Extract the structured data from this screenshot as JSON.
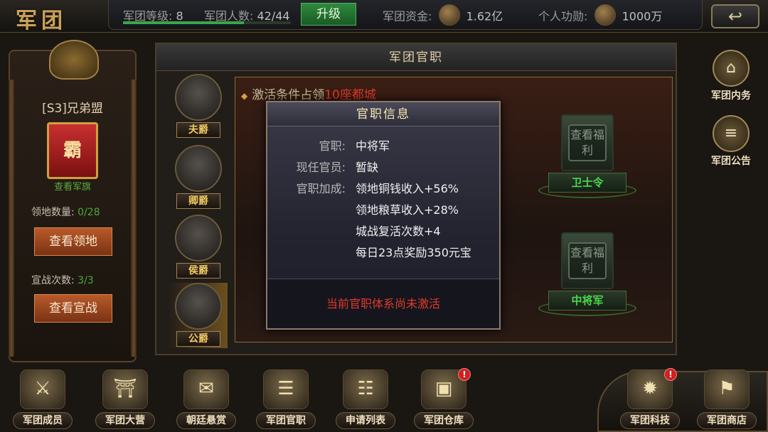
{
  "header": {
    "title": "军团",
    "level_label": "军团等级:",
    "level_value": "8",
    "members_label": "军团人数:",
    "members_value": "42/44",
    "level_progress": 0.72,
    "upgrade_label": "升级",
    "funds_label": "军团资金:",
    "funds_value": "1.62亿",
    "merit_label": "个人功勋:",
    "merit_value": "1000万",
    "back_icon": "back-arrow-icon"
  },
  "left_panel": {
    "guild_name": "[S3]兄弟盟",
    "flag_char": "霸",
    "view_flag": "查看军旗",
    "territory_label": "领地数量:",
    "territory_value": "0/28",
    "view_territory": "查看领地",
    "war_label": "宣战次数:",
    "war_value": "3/3",
    "view_war": "查看宣战"
  },
  "main": {
    "title": "军团官职",
    "activate_prefix": "激活条件占领",
    "activate_highlight": "10座都城",
    "ranks": [
      {
        "label": "夫爵"
      },
      {
        "label": "卿爵"
      },
      {
        "label": "侯爵"
      },
      {
        "label": "公爵"
      }
    ],
    "towers": [
      {
        "inner": "查看福利",
        "base": "卫士令"
      },
      {
        "inner": "查看福利",
        "base": "中将军"
      }
    ]
  },
  "popup": {
    "title": "官职信息",
    "post_label": "官职:",
    "post_value": "中将军",
    "holder_label": "现任官员:",
    "holder_value": "暂缺",
    "bonus_label": "官职加成:",
    "bonuses": [
      "领地铜钱收入+56%",
      "领地粮草收入+28%",
      "城战复活次数+4",
      "每日23点奖励350元宝"
    ],
    "footer": "当前官职体系尚未激活"
  },
  "side": {
    "affairs": "军团内务",
    "notice": "军团公告"
  },
  "bottom_nav": [
    {
      "label": "军团成员",
      "icon": "members-icon"
    },
    {
      "label": "军团大营",
      "icon": "camp-icon"
    },
    {
      "label": "朝廷悬赏",
      "icon": "bounty-icon"
    },
    {
      "label": "军团官职",
      "icon": "scroll-icon"
    },
    {
      "label": "申请列表",
      "icon": "list-icon"
    },
    {
      "label": "军团仓库",
      "icon": "chest-icon",
      "badge": "!"
    },
    {
      "label": "军团科技",
      "icon": "tech-icon",
      "badge": "!"
    },
    {
      "label": "军团商店",
      "icon": "shop-icon"
    }
  ],
  "colors": {
    "accent_gold": "#c9a15a",
    "alert_red": "#e03a2a",
    "ok_green": "#4aa83a"
  }
}
